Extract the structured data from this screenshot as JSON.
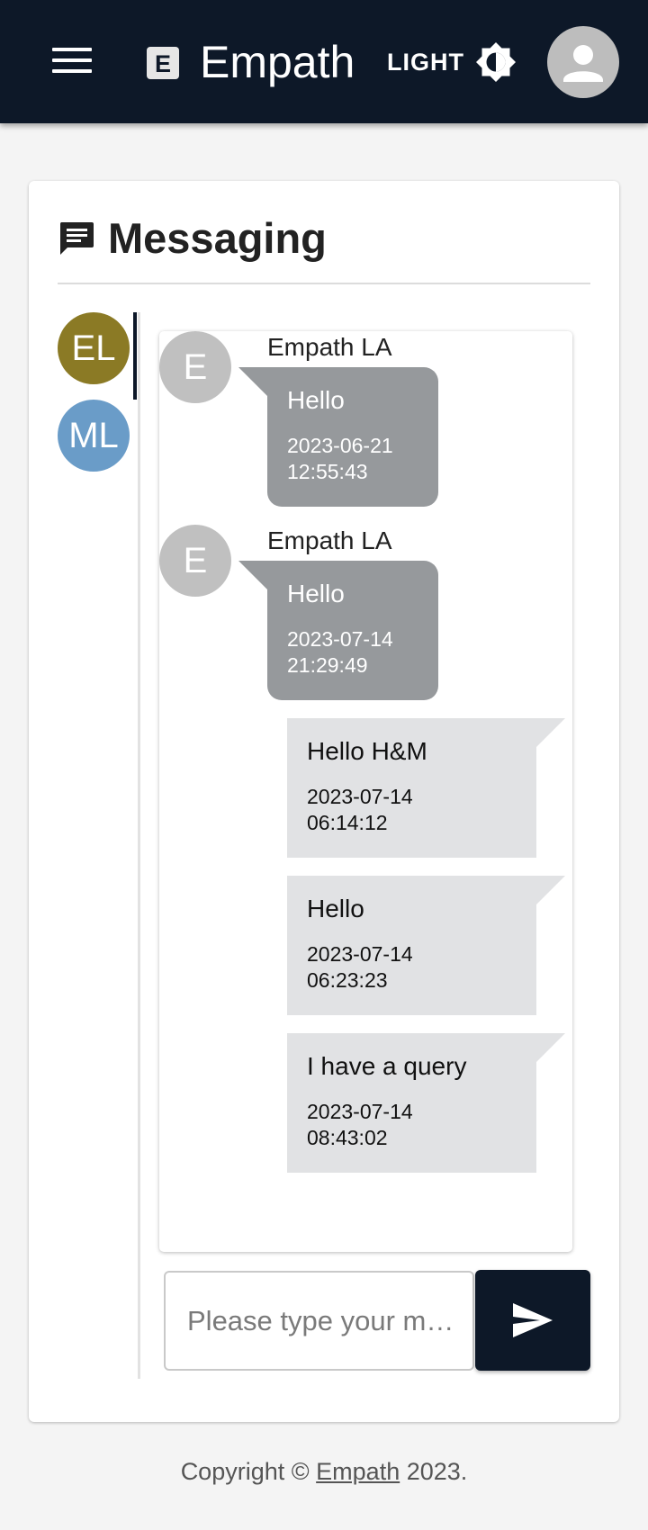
{
  "header": {
    "brand": "Empath",
    "logo_letter": "E",
    "theme_label": "LIGHT",
    "menu_icon": "hamburger-menu-icon",
    "theme_icon": "brightness-icon",
    "avatar_icon": "person-icon",
    "background": "#0d1828"
  },
  "messaging": {
    "title": "Messaging",
    "title_icon": "chat-icon",
    "contacts": [
      {
        "initials": "EL",
        "color": "#8b7a25",
        "selected": true
      },
      {
        "initials": "ML",
        "color": "#6a9cc8",
        "selected": false
      }
    ],
    "incoming": [
      {
        "avatar": "E",
        "sender": "Empath LA",
        "text": "Hello",
        "time": "2023-06-21 12:55:43"
      },
      {
        "avatar": "E",
        "sender": "Empath LA",
        "text": "Hello",
        "time": "2023-07-14 21:29:49"
      }
    ],
    "outgoing": [
      {
        "text": "Hello H&M",
        "time": "2023-07-14 06:14:12"
      },
      {
        "text": "Hello",
        "time": "2023-07-14 06:23:23"
      },
      {
        "text": "I have a query",
        "time": "2023-07-14 08:43:02"
      }
    ],
    "composer": {
      "placeholder": "Please type your m…",
      "value": "",
      "send_icon": "send-icon"
    }
  },
  "footer": {
    "prefix": "Copyright ©",
    "link": "Empath",
    "suffix": "2023."
  }
}
